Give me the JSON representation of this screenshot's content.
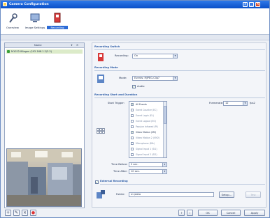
{
  "window": {
    "title": "Camera Configuration"
  },
  "toolbar": {
    "items": [
      {
        "label": "Overview",
        "icon": "wrench-icon"
      },
      {
        "label": "Image Settings",
        "icon": "monitor-icon"
      },
      {
        "label": "Recording",
        "icon": "recording-icon"
      }
    ]
  },
  "camera_list": {
    "header": "Name",
    "rows": [
      {
        "text": "M1022-Wlagen (192.168.1.2/2-2)"
      }
    ]
  },
  "recording_switch": {
    "header": "Recording Switch",
    "label": "Recording:",
    "value": "On"
  },
  "recording_mode": {
    "header": "Recording Mode",
    "mode_label": "Mode:",
    "mode_value": "Events: MJPEG-Clip?",
    "audio_label": "Audio",
    "audio_checked": true
  },
  "start_duration": {
    "header": "Recording Start and Duration",
    "start_trigger_label": "Start Trigger:",
    "framerate_label": "Framerate:",
    "framerate_value": "12",
    "framerate_unit": "fps2",
    "triggers": [
      {
        "label": "All Events",
        "checked": true,
        "enabled": true
      },
      {
        "label": "Event Counter (EC)",
        "checked": false,
        "enabled": false
      },
      {
        "label": "Event Login (EL)",
        "checked": false,
        "enabled": false
      },
      {
        "label": "Event Logout (EO)",
        "checked": false,
        "enabled": false
      },
      {
        "label": "Passive Infrared (PI)",
        "checked": false,
        "enabled": false
      },
      {
        "label": "Video Motion (VM)",
        "checked": true,
        "enabled": true
      },
      {
        "label": "Video Motion 2 (VM2)",
        "checked": false,
        "enabled": false
      },
      {
        "label": "Microphone (MA)",
        "checked": false,
        "enabled": false
      },
      {
        "label": "Signal Input 1 (SI1)",
        "checked": false,
        "enabled": false
      },
      {
        "label": "Signal Input 2 (SI2)",
        "checked": false,
        "enabled": false
      }
    ],
    "time_before_label": "Time Before:",
    "time_before_value": "2 sec.",
    "time_after_label": "Time After:",
    "time_after_value": "10 sec."
  },
  "external_recording": {
    "header": "External Recording",
    "checked": true,
    "folder_label": "Folder:",
    "folder_value": "m:\\data",
    "setup_label": "Setup...",
    "test_label": "Test"
  },
  "footer": {
    "ok_label": "OK",
    "cancel_label": "Cancel",
    "apply_label": "Apply"
  },
  "colors": {
    "title_bar": "#0a4fc8",
    "accent": "#2e5ea8",
    "selection": "#dcebc9"
  }
}
